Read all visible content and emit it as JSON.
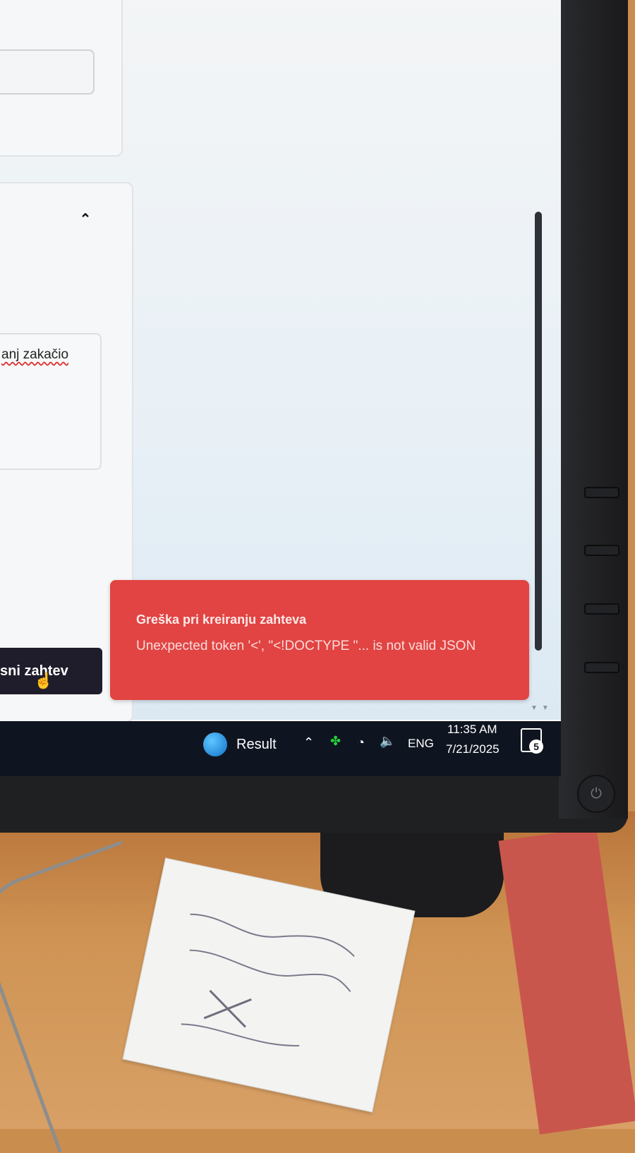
{
  "form": {
    "textarea_value": "anj zakačio",
    "submit_label": "sni zahtev"
  },
  "toast": {
    "title": "Greška pri kreiranju zahteva",
    "message": "Unexpected token '<', \"<!DOCTYPE \"... is not valid JSON",
    "background": "#e14442"
  },
  "taskbar": {
    "app_label": "Result",
    "language": "ENG",
    "time": "11:35 AM",
    "date": "7/21/2025",
    "notification_badge": "5"
  },
  "icons": {
    "chevron_up": "chevron-up-icon",
    "cursor": "hand-cursor-icon",
    "tray_up": "tray-chevron-icon",
    "clover": "clover-icon",
    "wifi": "wifi-icon",
    "volume": "volume-icon",
    "notification": "notification-icon",
    "power": "power-icon"
  }
}
